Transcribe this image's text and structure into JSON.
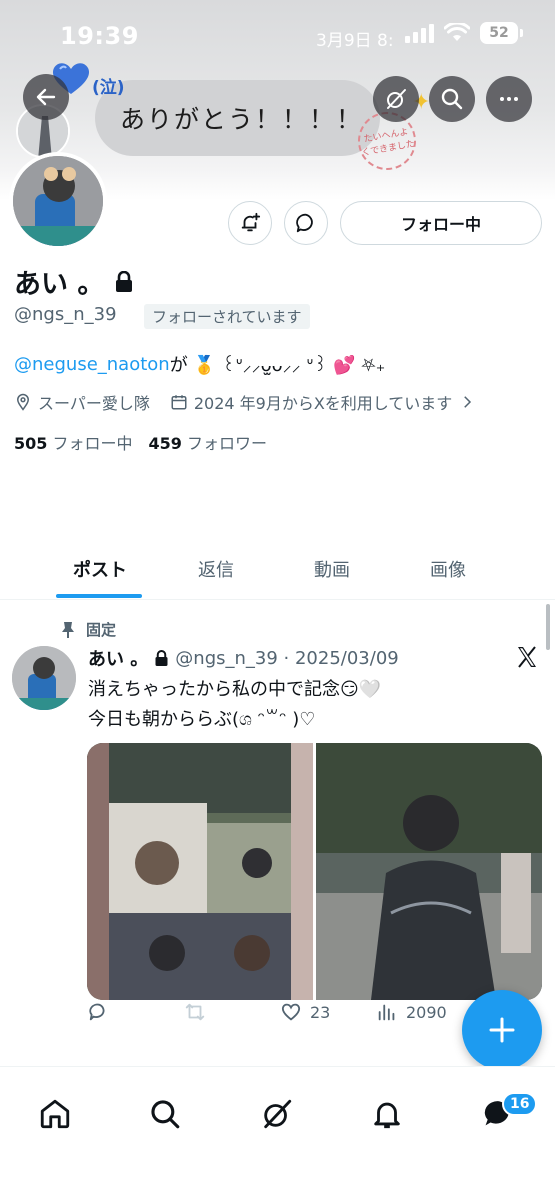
{
  "status_bar": {
    "time": "19:39",
    "date": "3月9日 8:",
    "battery": "52"
  },
  "header": {
    "bubble_text": "ありがとう！！！！",
    "cry_text": "(泣)",
    "stamp_text": "たいへんよくできました"
  },
  "profile": {
    "display_name": "あい 。",
    "handle": "@ngs_n_39",
    "follows_you": "フォローされています",
    "follow_button": "フォロー中",
    "bio_link": "@neguse_naoton",
    "bio_rest": " が 🥇 ꒰ᐡ⸝⸝ᴗ̫ᴗ⸝⸝ ᐡ꒱ 💕 ⛧₊",
    "location": "スーパー愛し隊",
    "joined": "2024 年9月からXを利用しています",
    "following_count": "505",
    "following_label": "フォロー中",
    "followers_count": "459",
    "followers_label": "フォロワー"
  },
  "tabs": [
    "ポスト",
    "返信",
    "動画",
    "画像"
  ],
  "post": {
    "pinned_label": "固定",
    "author_name": "あい 。",
    "handle_date": "@ngs_n_39 · 2025/03/09",
    "line1": "消えちゃったから私の中で記念😏🤍",
    "line2": "今日も朝かららぶ(ශ ᵔ꒳ᵔ )♡",
    "likes": "23",
    "views": "2090"
  },
  "nav": {
    "messages_badge": "16"
  },
  "colors": {
    "accent": "#1d9bf0",
    "text": "#0f1419",
    "secondary": "#536471"
  }
}
